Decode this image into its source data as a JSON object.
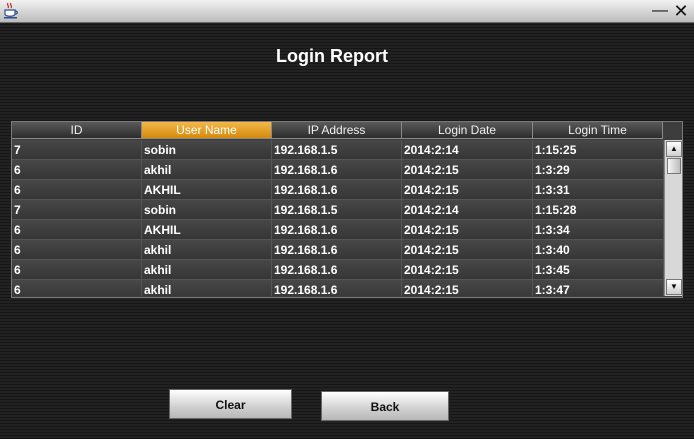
{
  "window": {
    "minimize_glyph": "—",
    "close_glyph": "✕",
    "app_icon": "java-cup-icon"
  },
  "page_title": "Login Report",
  "table": {
    "columns": [
      "ID",
      "User Name",
      "IP Address",
      "Login Date",
      "Login Time"
    ],
    "active_column": "User Name",
    "rows": [
      [
        "7",
        "sobin",
        "192.168.1.5",
        "2014:2:14",
        "1:15:25"
      ],
      [
        "6",
        "akhil",
        "192.168.1.6",
        "2014:2:15",
        "1:3:29"
      ],
      [
        "6",
        "AKHIL",
        "192.168.1.6",
        "2014:2:15",
        "1:3:31"
      ],
      [
        "7",
        "sobin",
        "192.168.1.5",
        "2014:2:14",
        "1:15:28"
      ],
      [
        "6",
        "AKHIL",
        "192.168.1.6",
        "2014:2:15",
        "1:3:34"
      ],
      [
        "6",
        "akhil",
        "192.168.1.6",
        "2014:2:15",
        "1:3:40"
      ],
      [
        "6",
        "akhil",
        "192.168.1.6",
        "2014:2:15",
        "1:3:45"
      ],
      [
        "6",
        "akhil",
        "192.168.1.6",
        "2014:2:15",
        "1:3:47"
      ]
    ],
    "scroll_up_glyph": "▲",
    "scroll_down_glyph": "▼"
  },
  "buttons": {
    "clear": "Clear",
    "back": "Back"
  },
  "colors": {
    "header_active": "#e8a020",
    "background": "#1c1c1c"
  }
}
